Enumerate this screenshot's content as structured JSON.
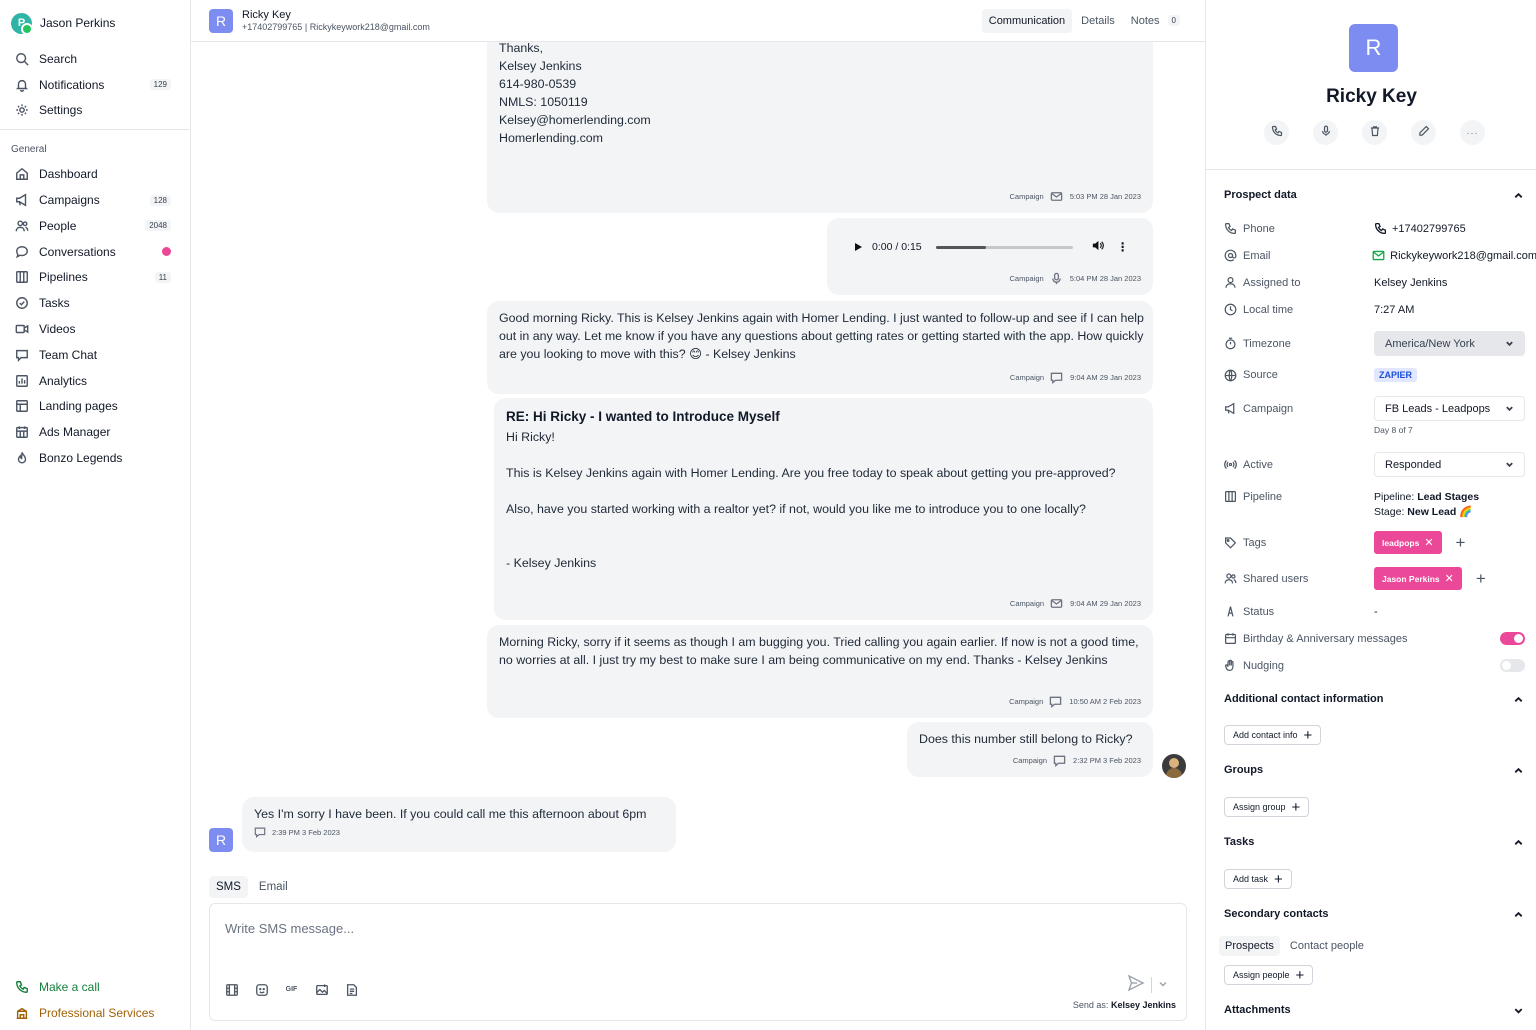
{
  "user": {
    "name": "Jason Perkins",
    "logo_letter": "P"
  },
  "sidebar": {
    "top_items": [
      {
        "label": "Search",
        "icon": "search-icon"
      },
      {
        "label": "Notifications",
        "icon": "bell-icon",
        "count": "129"
      },
      {
        "label": "Settings",
        "icon": "gear-icon"
      }
    ],
    "section_title": "General",
    "items": [
      {
        "label": "Dashboard",
        "icon": "home-icon"
      },
      {
        "label": "Campaigns",
        "icon": "megaphone-icon",
        "count": "128"
      },
      {
        "label": "People",
        "icon": "people-icon",
        "count": "2048"
      },
      {
        "label": "Conversations",
        "icon": "chat-bubble-icon",
        "dot": "#ec4899"
      },
      {
        "label": "Pipelines",
        "icon": "columns-icon",
        "count": "11"
      },
      {
        "label": "Tasks",
        "icon": "check-circle-icon"
      },
      {
        "label": "Videos",
        "icon": "video-icon"
      },
      {
        "label": "Team Chat",
        "icon": "team-chat-icon"
      },
      {
        "label": "Analytics",
        "icon": "analytics-icon"
      },
      {
        "label": "Landing pages",
        "icon": "layout-icon"
      },
      {
        "label": "Ads Manager",
        "icon": "calendar-grid-icon"
      },
      {
        "label": "Bonzo Legends",
        "icon": "flame-icon"
      }
    ],
    "bottom": {
      "call": {
        "label": "Make a call",
        "icon": "phone-icon",
        "color": "#15803d"
      },
      "services": {
        "label": "Professional Services",
        "icon": "building-icon",
        "color": "#a16207"
      }
    }
  },
  "header": {
    "avatar_letter": "R",
    "name": "Ricky Key",
    "phone": "+17402799765",
    "separator": "|",
    "email": "Rickykeywork218@gmail.com",
    "tabs": [
      {
        "label": "Communication",
        "active": true
      },
      {
        "label": "Details"
      },
      {
        "label": "Notes",
        "badge": "0"
      }
    ]
  },
  "messages": [
    {
      "type": "email-tail",
      "text": "Thanks,\nKelsey Jenkins\n614-980-0539\nNMLS: 1050119\nKelsey@homerlending.com\nHomerlending.com",
      "channel": "Campaign",
      "icon": "mail-icon",
      "time": "5:03 PM 28 Jan 2023"
    },
    {
      "type": "voicemail",
      "time_display": "0:00 / 0:15",
      "channel": "Campaign",
      "icon": "mic-icon",
      "time": "5:04 PM 28 Jan 2023"
    },
    {
      "type": "sms",
      "text": "Good morning Ricky. This is Kelsey Jenkins again with Homer Lending. I just wanted to follow-up and see if I can help out in any way. Let me know if you have any questions about getting rates or getting started with the app. How quickly are you looking to move with this? 😊 - Kelsey Jenkins",
      "channel": "Campaign",
      "icon": "sms-icon",
      "time": "9:04 AM 29 Jan 2023"
    },
    {
      "type": "email",
      "subject": "RE: Hi Ricky - I wanted to Introduce Myself",
      "text": "Hi Ricky!\n\nThis is Kelsey Jenkins again with Homer Lending. Are you free today to speak about getting you pre-approved?\n\nAlso, have you started working with a realtor yet? if not, would you like me to introduce you to one locally?\n\n\n- Kelsey Jenkins",
      "channel": "Campaign",
      "icon": "mail-icon",
      "time": "9:04 AM 29 Jan 2023"
    },
    {
      "type": "sms",
      "text": "Morning Ricky, sorry if it seems as though I am bugging you. Tried calling you again earlier. If now is not a good time, no worries at all. I just try my best to make sure I am being communicative on my end. Thanks - Kelsey Jenkins",
      "channel": "Campaign",
      "icon": "sms-icon",
      "time": "10:50 AM 2 Feb 2023"
    },
    {
      "type": "sms",
      "text": "Does this number still belong to Ricky?",
      "channel": "Campaign",
      "icon": "sms-icon",
      "time": "2:32 PM 3 Feb 2023"
    },
    {
      "type": "incoming",
      "text": "Yes I'm sorry I have been. If you could call me this afternoon about 6pm",
      "icon": "sms-icon",
      "time": "2:39 PM 3 Feb 2023",
      "avatar_letter": "R"
    }
  ],
  "composer": {
    "tabs": [
      {
        "label": "SMS",
        "active": true
      },
      {
        "label": "Email"
      }
    ],
    "placeholder": "Write SMS message...",
    "tools": [
      "film-icon",
      "emoji-icon",
      "GIF",
      "image-icon",
      "document-icon"
    ],
    "send_as_label": "Send as:",
    "send_as_name": "Kelsey Jenkins"
  },
  "profile": {
    "avatar_letter": "R",
    "name": "Ricky Key",
    "actions": [
      "phone-icon",
      "mic-icon",
      "trash-icon",
      "pencil-icon",
      "more-icon"
    ],
    "sections": {
      "prospect": "Prospect data",
      "additional": "Additional contact information",
      "groups": "Groups",
      "tasks": "Tasks",
      "secondary": "Secondary contacts",
      "attachments": "Attachments"
    },
    "fields": {
      "phone": {
        "label": "Phone",
        "value": "+17402799765"
      },
      "email": {
        "label": "Email",
        "value": "Rickykeywork218@gmail.com"
      },
      "assigned": {
        "label": "Assigned to",
        "value": "Kelsey Jenkins"
      },
      "local_time": {
        "label": "Local time",
        "value": "7:27 AM"
      },
      "timezone": {
        "label": "Timezone",
        "value": "America/New York"
      },
      "source": {
        "label": "Source",
        "value": "ZAPIER"
      },
      "campaign": {
        "label": "Campaign",
        "value": "FB Leads - Leadpops",
        "sub": "Day 8 of 7"
      },
      "active": {
        "label": "Active",
        "value": "Responded"
      },
      "pipeline": {
        "label": "Pipeline",
        "pipeline_key": "Pipeline:",
        "pipeline_val": "Lead Stages",
        "stage_key": "Stage:",
        "stage_val": "New Lead 🌈"
      },
      "tags": {
        "label": "Tags",
        "value": "leadpops"
      },
      "shared": {
        "label": "Shared users",
        "value": "Jason Perkins"
      },
      "status": {
        "label": "Status",
        "value": "-"
      },
      "birthday": {
        "label": "Birthday & Anniversary messages",
        "on": true
      },
      "nudging": {
        "label": "Nudging",
        "on": false
      }
    },
    "buttons": {
      "add_contact": "Add contact info",
      "assign_group": "Assign group",
      "add_task": "Add task",
      "assign_people": "Assign people"
    },
    "secondary_tabs": [
      {
        "label": "Prospects",
        "active": true
      },
      {
        "label": "Contact people"
      }
    ],
    "accent": "#ec4899"
  }
}
